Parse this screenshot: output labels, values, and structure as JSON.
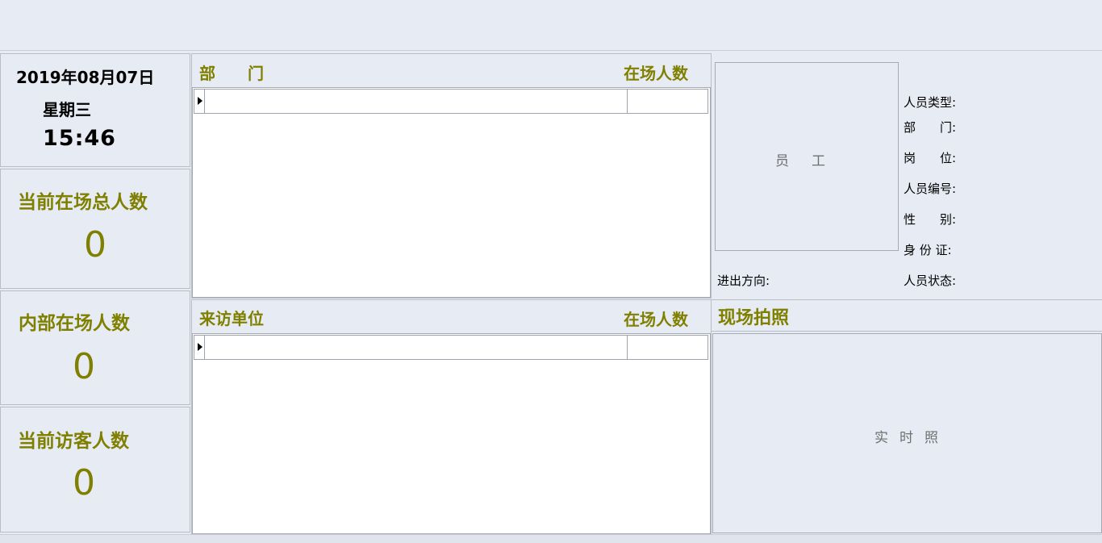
{
  "clock": {
    "date": "2019年08月07日",
    "weekday": "星期三",
    "time": "15:46"
  },
  "stats": {
    "total_label": "当前在场总人数",
    "total_value": "0",
    "internal_label": "内部在场人数",
    "internal_value": "0",
    "visitor_label": "当前访客人数",
    "visitor_value": "0"
  },
  "dept_grid": {
    "header_dept": "部　　门",
    "header_count": "在场人数"
  },
  "visitor_grid": {
    "header_unit": "来访单位",
    "header_count": "在场人数"
  },
  "employee": {
    "photo_placeholder": "员工",
    "fields": {
      "type": "人员类型:",
      "dept": "部　　门:",
      "post": "岗　　位:",
      "number": "人员编号:",
      "gender": "性　　别:",
      "id_card": "身 份 证:",
      "direction": "进出方向:",
      "status": "人员状态:"
    }
  },
  "live": {
    "title": "现场拍照",
    "placeholder": "实时照"
  },
  "colors": {
    "accent_olive": "#808000",
    "background": "#e7ebf4"
  }
}
